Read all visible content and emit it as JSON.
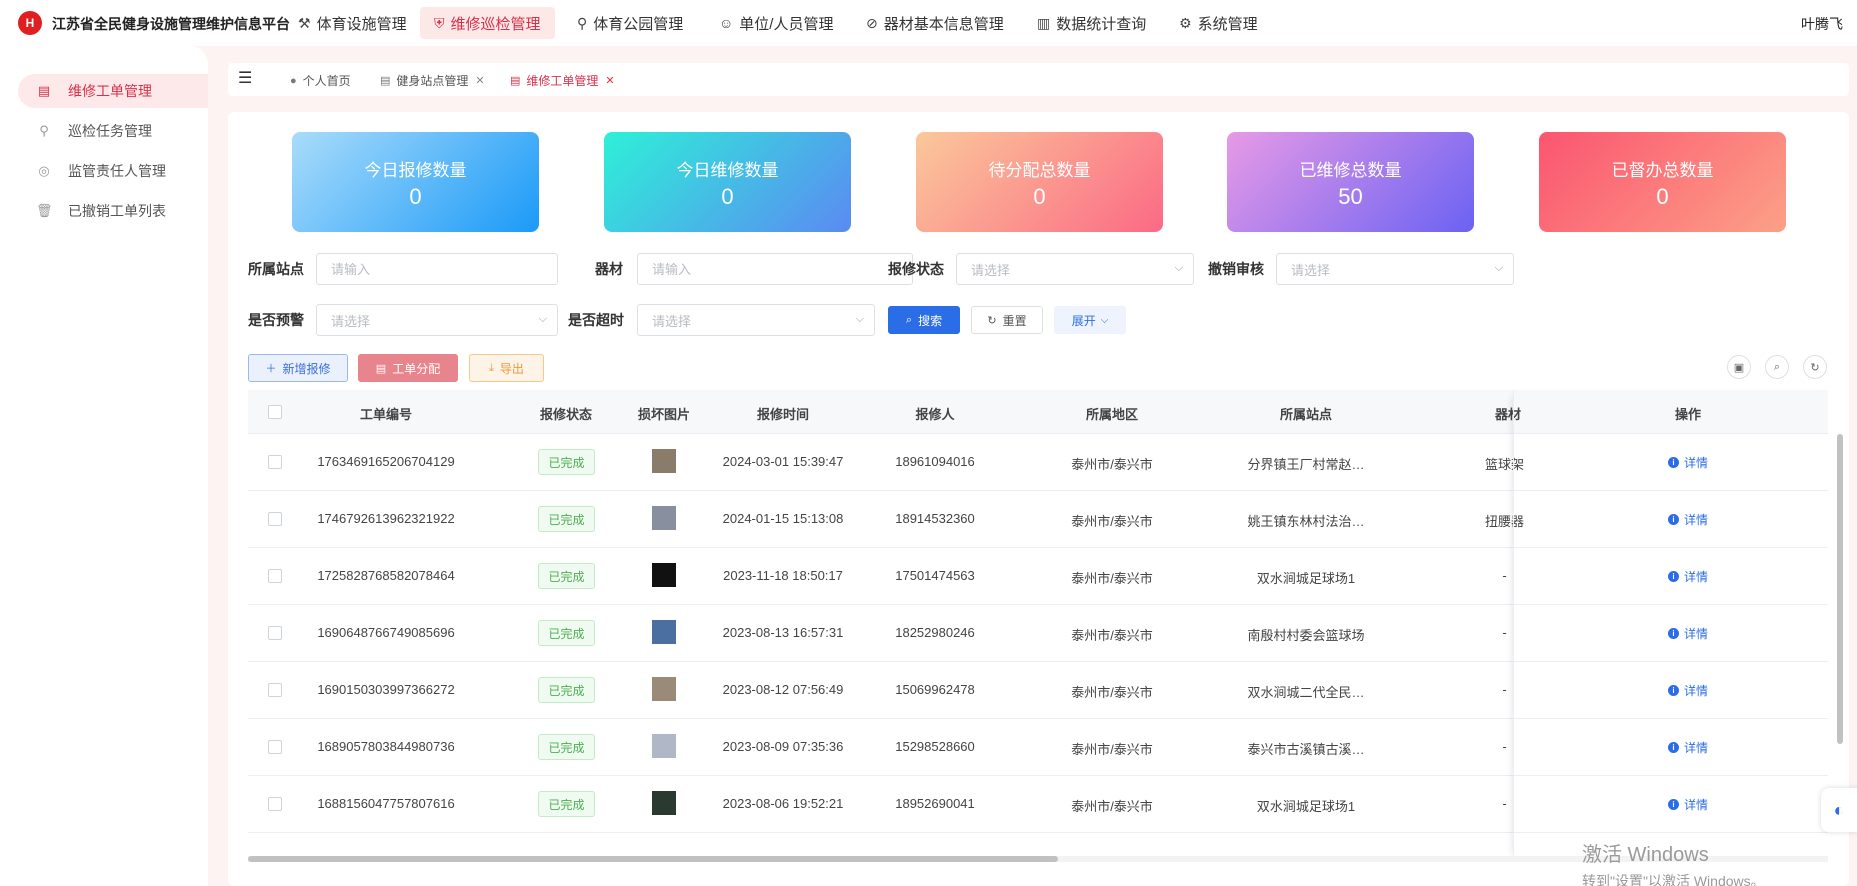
{
  "header": {
    "logo_text": "H",
    "app_title": "江苏省全民健身设施管理维护信息平台",
    "nav": [
      {
        "label": "体育设施管理",
        "icon": "dumbbell-icon",
        "active": false
      },
      {
        "label": "维修巡检管理",
        "icon": "shield-icon",
        "active": true
      },
      {
        "label": "体育公园管理",
        "icon": "tree-icon",
        "active": false
      },
      {
        "label": "单位/人员管理",
        "icon": "user-icon",
        "active": false
      },
      {
        "label": "器材基本信息管理",
        "icon": "compass-icon",
        "active": false
      },
      {
        "label": "数据统计查询",
        "icon": "bar-chart-icon",
        "active": false
      },
      {
        "label": "系统管理",
        "icon": "gear-icon",
        "active": false
      }
    ],
    "user_name": "叶腾飞"
  },
  "sidebar": {
    "items": [
      {
        "label": "维修工单管理",
        "icon": "document-icon",
        "active": true
      },
      {
        "label": "巡检任务管理",
        "icon": "location-pin-icon",
        "active": false
      },
      {
        "label": "监管责任人管理",
        "icon": "badge-icon",
        "active": false
      },
      {
        "label": "已撤销工单列表",
        "icon": "trash-icon",
        "active": false
      }
    ]
  },
  "tabs": [
    {
      "label": "个人首页",
      "icon": "user-icon",
      "closable": false,
      "active": false
    },
    {
      "label": "健身站点管理",
      "icon": "document-icon",
      "closable": true,
      "active": false
    },
    {
      "label": "维修工单管理",
      "icon": "document-icon",
      "closable": true,
      "active": true
    }
  ],
  "stats": [
    {
      "label": "今日报修数量",
      "value": "0"
    },
    {
      "label": "今日维修数量",
      "value": "0"
    },
    {
      "label": "待分配总数量",
      "value": "0"
    },
    {
      "label": "已维修总数量",
      "value": "50"
    },
    {
      "label": "已督办总数量",
      "value": "0"
    }
  ],
  "filters": {
    "station": {
      "label": "所属站点",
      "placeholder": "请输入"
    },
    "equipment": {
      "label": "器材",
      "placeholder": "请输入"
    },
    "repair_status": {
      "label": "报修状态",
      "placeholder": "请选择"
    },
    "revoke_review": {
      "label": "撤销审核",
      "placeholder": "请选择"
    },
    "warning": {
      "label": "是否预警",
      "placeholder": "请选择"
    },
    "overtime": {
      "label": "是否超时",
      "placeholder": "请选择"
    }
  },
  "buttons": {
    "search": "搜索",
    "reset": "重置",
    "expand": "展开",
    "add": "新增报修",
    "assign": "工单分配",
    "export": "导出"
  },
  "table": {
    "columns": [
      "工单编号",
      "报修状态",
      "损坏图片",
      "报修时间",
      "报修人",
      "所属地区",
      "所属站点",
      "器材",
      "操作"
    ],
    "rows": [
      {
        "id": "1763469165206704129",
        "status": "已完成",
        "time": "2024-03-01 15:39:47",
        "reporter": "18961094016",
        "region": "泰州市/泰兴市",
        "station": "分界镇王厂村常赵…",
        "equipment": "篮球架",
        "action": "详情",
        "thumb": "#8a7c6a"
      },
      {
        "id": "1746792613962321922",
        "status": "已完成",
        "time": "2024-01-15 15:13:08",
        "reporter": "18914532360",
        "region": "泰州市/泰兴市",
        "station": "姚王镇东林村法治…",
        "equipment": "扭腰器",
        "action": "详情",
        "thumb": "#8890a0"
      },
      {
        "id": "1725828768582078464",
        "status": "已完成",
        "time": "2023-11-18 18:50:17",
        "reporter": "17501474563",
        "region": "泰州市/泰兴市",
        "station": "双水涧城足球场1",
        "equipment": "-",
        "action": "详情",
        "thumb": "#111111"
      },
      {
        "id": "1690648766749085696",
        "status": "已完成",
        "time": "2023-08-13 16:57:31",
        "reporter": "18252980246",
        "region": "泰州市/泰兴市",
        "station": "南殷村村委会篮球场",
        "equipment": "-",
        "action": "详情",
        "thumb": "#4a6fa0"
      },
      {
        "id": "1690150303997366272",
        "status": "已完成",
        "time": "2023-08-12 07:56:49",
        "reporter": "15069962478",
        "region": "泰州市/泰兴市",
        "station": "双水涧城二代全民…",
        "equipment": "-",
        "action": "详情",
        "thumb": "#9a8a78"
      },
      {
        "id": "1689057803844980736",
        "status": "已完成",
        "time": "2023-08-09 07:35:36",
        "reporter": "15298528660",
        "region": "泰州市/泰兴市",
        "station": "泰兴市古溪镇古溪…",
        "equipment": "-",
        "action": "详情",
        "thumb": "#b0b8c8"
      },
      {
        "id": "1688156047757807616",
        "status": "已完成",
        "time": "2023-08-06 19:52:21",
        "reporter": "18952690041",
        "region": "泰州市/泰兴市",
        "station": "双水涧城足球场1",
        "equipment": "-",
        "action": "详情",
        "thumb": "#2a3a30"
      }
    ]
  },
  "watermark": {
    "line1": "激活 Windows",
    "line2": "转到\"设置\"以激活 Windows。"
  }
}
